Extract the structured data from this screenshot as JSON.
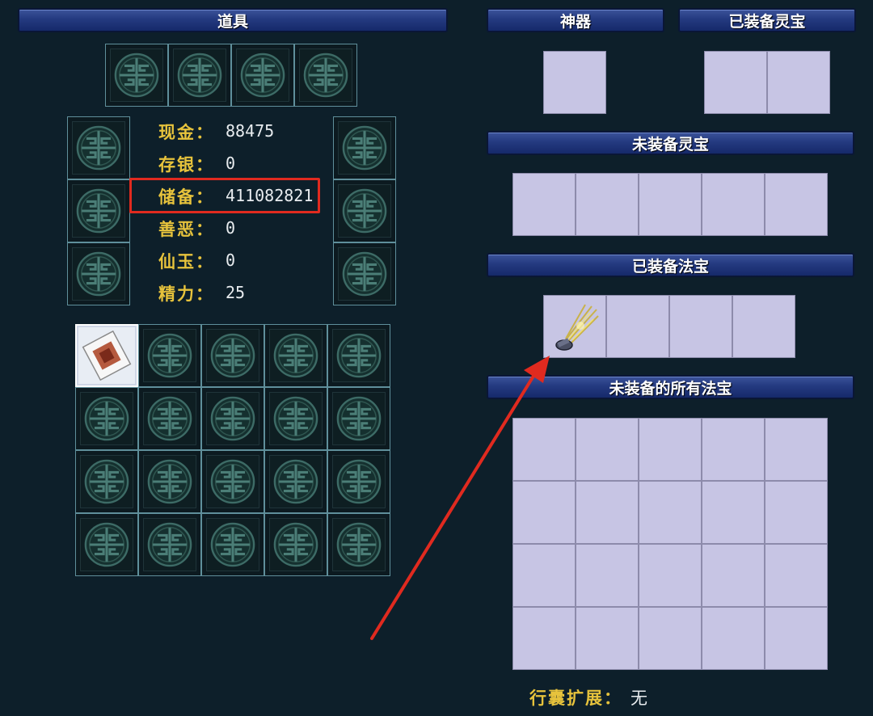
{
  "headers": {
    "items": "道具",
    "artifact": "神器",
    "equipped_spirit": "已装备灵宝",
    "unequipped_spirit": "未装备灵宝",
    "equipped_magic": "已装备法宝",
    "all_unequipped_magic": "未装备的所有法宝"
  },
  "stats": [
    {
      "label": "现金：",
      "value": "88475"
    },
    {
      "label": "存银：",
      "value": "0"
    },
    {
      "label": "储备：",
      "value": "411082821"
    },
    {
      "label": "善恶：",
      "value": "0"
    },
    {
      "label": "仙玉：",
      "value": "0"
    },
    {
      "label": "精力：",
      "value": "25"
    }
  ],
  "footer": {
    "label": "行囊扩展：",
    "value": "无"
  },
  "icons": {
    "empty_slot": "shou-symbol-icon",
    "first_item": "red-seal-paper-icon",
    "magic_item": "golden-rake-icon"
  },
  "colors": {
    "background": "#0d1f2a",
    "header": "#243a80",
    "label_gold": "#e7c33c",
    "lavender_slot": "#c7c5e4",
    "highlight_red": "#e02a1f"
  }
}
